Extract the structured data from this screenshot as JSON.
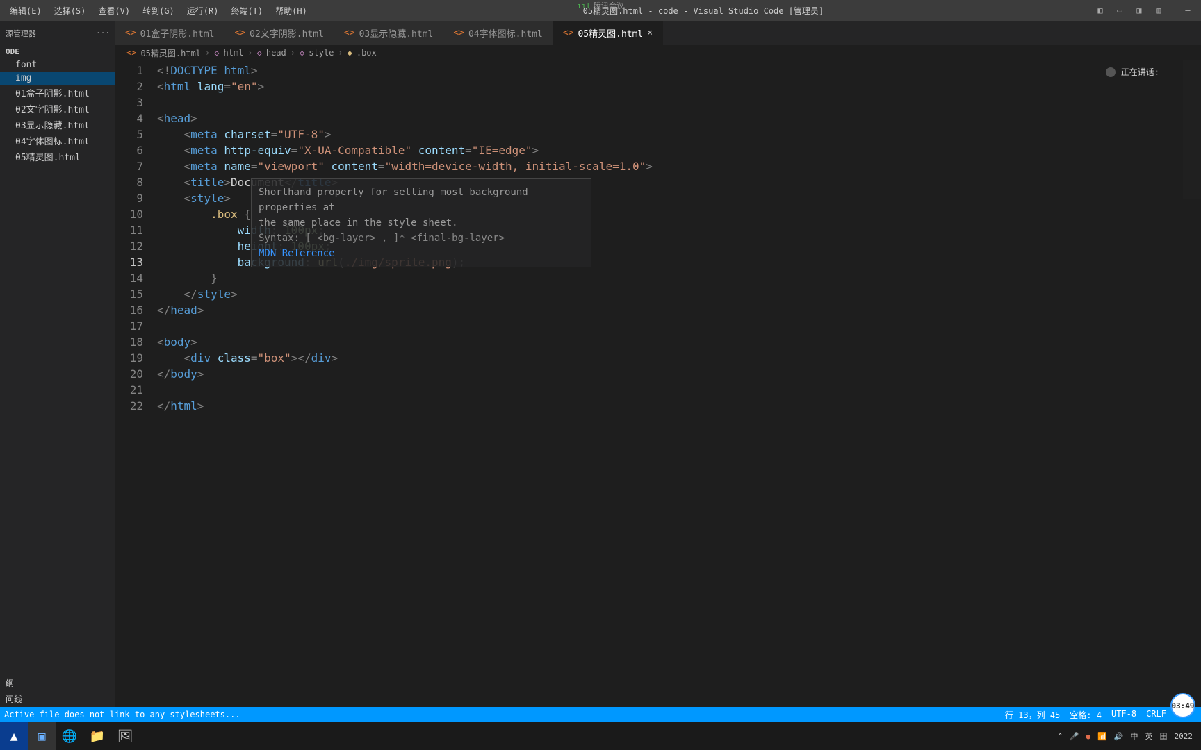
{
  "menu": {
    "edit": "编辑(E)",
    "select": "选择(S)",
    "view": "查看(V)",
    "go": "转到(G)",
    "run": "运行(R)",
    "terminal": "终端(T)",
    "help": "帮助(H)"
  },
  "meeting": {
    "signal": "ııl",
    "label": "腾讯会议"
  },
  "window_title": "05精灵图.html - code - Visual Studio Code [管理员]",
  "sidebar": {
    "header_label": "源管理器",
    "section": "ODE",
    "items": [
      {
        "label": "font"
      },
      {
        "label": "img"
      },
      {
        "label": "01盒子阴影.html"
      },
      {
        "label": "02文字阴影.html"
      },
      {
        "label": "03显示隐藏.html"
      },
      {
        "label": "04字体图标.html"
      },
      {
        "label": "05精灵图.html"
      }
    ],
    "bottom": [
      "纲",
      "问线"
    ]
  },
  "tabs": [
    {
      "label": "01盒子阴影.html"
    },
    {
      "label": "02文字阴影.html"
    },
    {
      "label": "03显示隐藏.html"
    },
    {
      "label": "04字体图标.html"
    },
    {
      "label": "05精灵图.html"
    }
  ],
  "breadcrumb": [
    "05精灵图.html",
    "html",
    "head",
    "style",
    ".box"
  ],
  "code_lines": 22,
  "code": {
    "l1_doc": "DOCTYPE",
    "l1_html": "html",
    "l2_lang": "lang",
    "l2_val": "\"en\"",
    "l4_head": "head",
    "l5_meta": "meta",
    "l5_charset": "charset",
    "l5_val": "\"UTF-8\"",
    "l6_he": "http-equiv",
    "l6_hev": "\"X-UA-Compatible\"",
    "l6_content": "content",
    "l6_cv": "\"IE=edge\"",
    "l7_name": "name",
    "l7_nv": "\"viewport\"",
    "l7_cv": "\"width=device-width, initial-scale=1.0\"",
    "l8_title": "title",
    "l8_doc": "Document",
    "l9_style": "style",
    "l10_sel": ".box",
    "l11_p": "width",
    "l11_v": "100px",
    "l12_p": "height",
    "l12_v": "100px",
    "l13_p": "background",
    "l13_f": "url",
    "l13_path": "./img/sprite.png",
    "l18_body": "body",
    "l19_div": "div",
    "l19_class": "class",
    "l19_cv": "\"box\"",
    "l2_html": "html"
  },
  "hover": {
    "line1": "Shorthand property for setting most background properties at",
    "line2": "the same place in the style sheet.",
    "syntax": "Syntax: [ <bg-layer> , ]* <final-bg-layer>",
    "ref": "MDN Reference"
  },
  "speaking": "正在讲话:",
  "status": {
    "left": "Active file does not link to any stylesheets...",
    "rc": "行 13，列 45",
    "spaces": "空格: 4",
    "enc": "UTF-8",
    "eol": "CRLF"
  },
  "clock_time": "03:49",
  "tray": {
    "zh": "中",
    "ime": "英",
    "grid": "田"
  },
  "taskbar_right_date": "2022"
}
